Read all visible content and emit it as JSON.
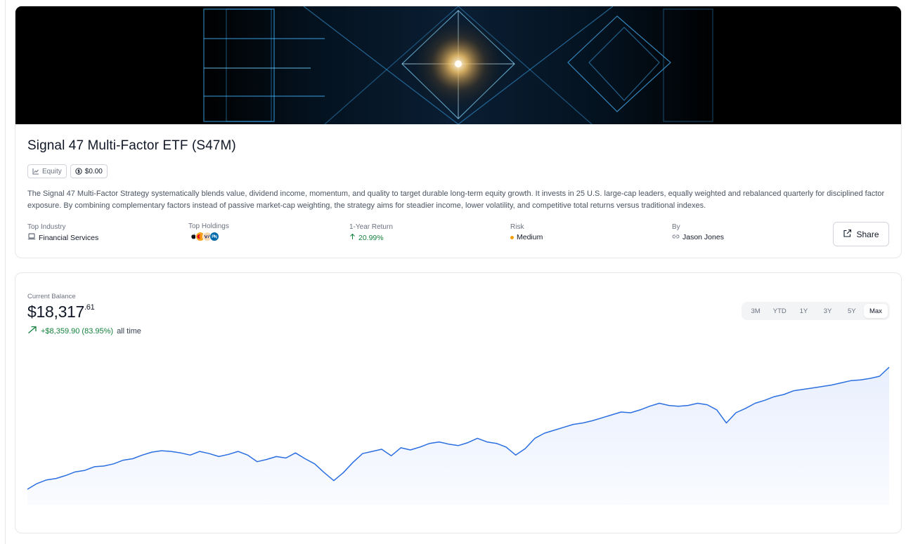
{
  "fund": {
    "title": "Signal 47 Multi-Factor ETF (S47M)",
    "tags": {
      "category": "Equity",
      "price": "$0.00"
    },
    "description": "The Signal 47 Multi-Factor Strategy systematically blends value, dividend income, momentum, and quality to target durable long-term equity growth. It invests in 25 U.S. large-cap leaders, equally weighted and rebalanced quarterly for disciplined factor exposure. By combining complementary factors instead of passive market-cap weighting, the strategy aims for steadier income, lower volatility, and competitive total returns versus traditional indexes.",
    "meta": {
      "top_industry": {
        "label": "Top Industry",
        "value": "Financial Services",
        "icon": "laptop-icon"
      },
      "top_holdings": {
        "label": "Top Holdings",
        "logos": [
          "apple-logo",
          "mastercard-logo",
          "visa-logo",
          "pnc-logo"
        ]
      },
      "one_year_return": {
        "label": "1-Year Return",
        "value": "20.99%",
        "icon": "arrow-up-icon",
        "color": "#15803d"
      },
      "risk": {
        "label": "Risk",
        "value": "Medium",
        "color": "#f59e0b"
      },
      "by": {
        "label": "By",
        "value": "Jason Jones",
        "icon": "link-icon"
      }
    },
    "share_label": "Share"
  },
  "balance": {
    "label": "Current Balance",
    "dollars": "$18,317",
    "cents": ".61",
    "change": "+$8,359.90 (83.95%)",
    "period": "all time",
    "up_color": "#15803d"
  },
  "ranges": [
    {
      "label": "3M",
      "active": false
    },
    {
      "label": "YTD",
      "active": false
    },
    {
      "label": "1Y",
      "active": false
    },
    {
      "label": "3Y",
      "active": false
    },
    {
      "label": "5Y",
      "active": false
    },
    {
      "label": "Max",
      "active": true
    }
  ],
  "chart_data": {
    "type": "area",
    "title": "",
    "xlabel": "",
    "ylabel": "",
    "line_color": "#2b6fe0",
    "fill_color": "#e8effd",
    "grid": false,
    "legend": "none",
    "ylim": [
      8900,
      19000
    ],
    "series": [
      {
        "values": [
          9958,
          10350,
          10600,
          10700,
          10900,
          11150,
          11250,
          11500,
          11550,
          11700,
          11950,
          12050,
          12300,
          12500,
          12600,
          12550,
          12450,
          12300,
          12550,
          12400,
          12200,
          12350,
          12550,
          12300,
          11850,
          12000,
          12200,
          12100,
          12450,
          12050,
          11700,
          11100,
          10550,
          11100,
          11800,
          12400,
          12550,
          12700,
          12250,
          12800,
          12650,
          12850,
          13100,
          13200,
          13050,
          12950,
          13150,
          13450,
          13200,
          13100,
          12850,
          12300,
          12750,
          13450,
          13800,
          14000,
          14200,
          14400,
          14500,
          14650,
          14850,
          15050,
          15250,
          15200,
          15400,
          15650,
          15850,
          15700,
          15650,
          15700,
          15850,
          15750,
          15400,
          14500,
          15200,
          15500,
          15850,
          16050,
          16300,
          16450,
          16700,
          16800,
          16900,
          17000,
          17100,
          17250,
          17400,
          17450,
          17550,
          17700,
          18317
        ]
      }
    ]
  }
}
